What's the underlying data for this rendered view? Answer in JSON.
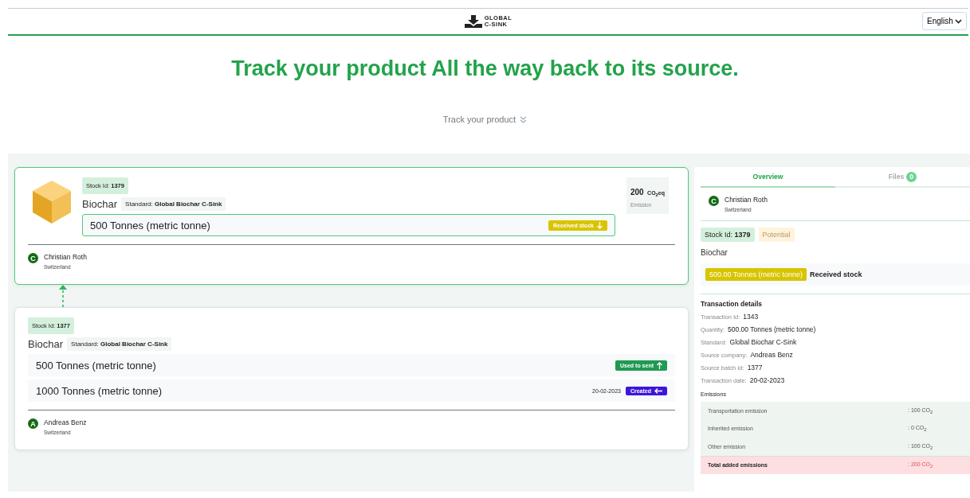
{
  "header": {
    "logo_top": "GLOBAL",
    "logo_bottom": "C-SINK",
    "language": "English"
  },
  "headline": "Track your product All the way back to its source.",
  "track_link": "Track your product",
  "stocks": [
    {
      "selected": true,
      "show_icon": true,
      "stock_label": "Stock Id:",
      "stock_id": "1379",
      "product": "Biochar",
      "standard_label": "Standard:",
      "standard": "Global Biochar C-Sink",
      "emission": {
        "value": "200",
        "unit": "CO$_{2}$eq",
        "label": "Emission"
      },
      "quantities": [
        {
          "text": "500 Tonnes (metric tonne)",
          "kind": "received",
          "badge": "Received stock"
        }
      ],
      "owner": {
        "initial": "C",
        "name": "Christian Roth",
        "country": "Switzerland"
      }
    },
    {
      "selected": false,
      "show_icon": false,
      "stock_label": "Stock Id:",
      "stock_id": "1377",
      "product": "Biochar",
      "standard_label": "Standard:",
      "standard": "Global Biochar C-Sink",
      "quantities": [
        {
          "text": "500 Tonnes (metric tonne)",
          "kind": "used",
          "badge": "Used to sent"
        },
        {
          "text": "1000 Tonnes (metric tonne)",
          "kind": "created",
          "badge": "Created",
          "date": "20-02-2023"
        }
      ],
      "owner": {
        "initial": "A",
        "name": "Andreas Benz",
        "country": "Switzerland"
      }
    }
  ],
  "details": {
    "tabs": [
      {
        "label": "Overview",
        "selected": true
      },
      {
        "label": "Files",
        "selected": false,
        "count": "0"
      }
    ],
    "owner": {
      "initial": "C",
      "name": "Christian Roth",
      "country": "Switzerland"
    },
    "stock_label": "Stock Id:",
    "stock_id": "1379",
    "status": "Potential",
    "product": "Biochar",
    "quantity": "500.00 Tonnes (metric tonne)",
    "quantity_note": "Received stock",
    "transaction_title": "Transaction details",
    "fields": [
      {
        "label": "Transaction Id:",
        "value": "1343"
      },
      {
        "label": "Quantity:",
        "value": "500.00 Tonnes (metric tonne)"
      },
      {
        "label": "Standard:",
        "value": "Global Biochar C-Sink"
      },
      {
        "label": "Source company:",
        "value": "Andreas Benz"
      },
      {
        "label": "Source batch Id:",
        "value": "1377"
      },
      {
        "label": "Transaction date:",
        "value": "20-02-2023"
      }
    ],
    "emissions_title": "Emissions",
    "emissions": [
      {
        "label": "Transportation emission",
        "value": ": 100 CO$_{2}$",
        "kind": "item"
      },
      {
        "label": "Inherited emission",
        "value": ": 0 CO$_{2}$",
        "kind": "item"
      },
      {
        "label": "Other emission",
        "value": ": 100 CO$_{2}$",
        "kind": "item"
      },
      {
        "label": "Total added emissions",
        "value": ": 200 CO$_{2}$",
        "kind": "total"
      }
    ]
  }
}
